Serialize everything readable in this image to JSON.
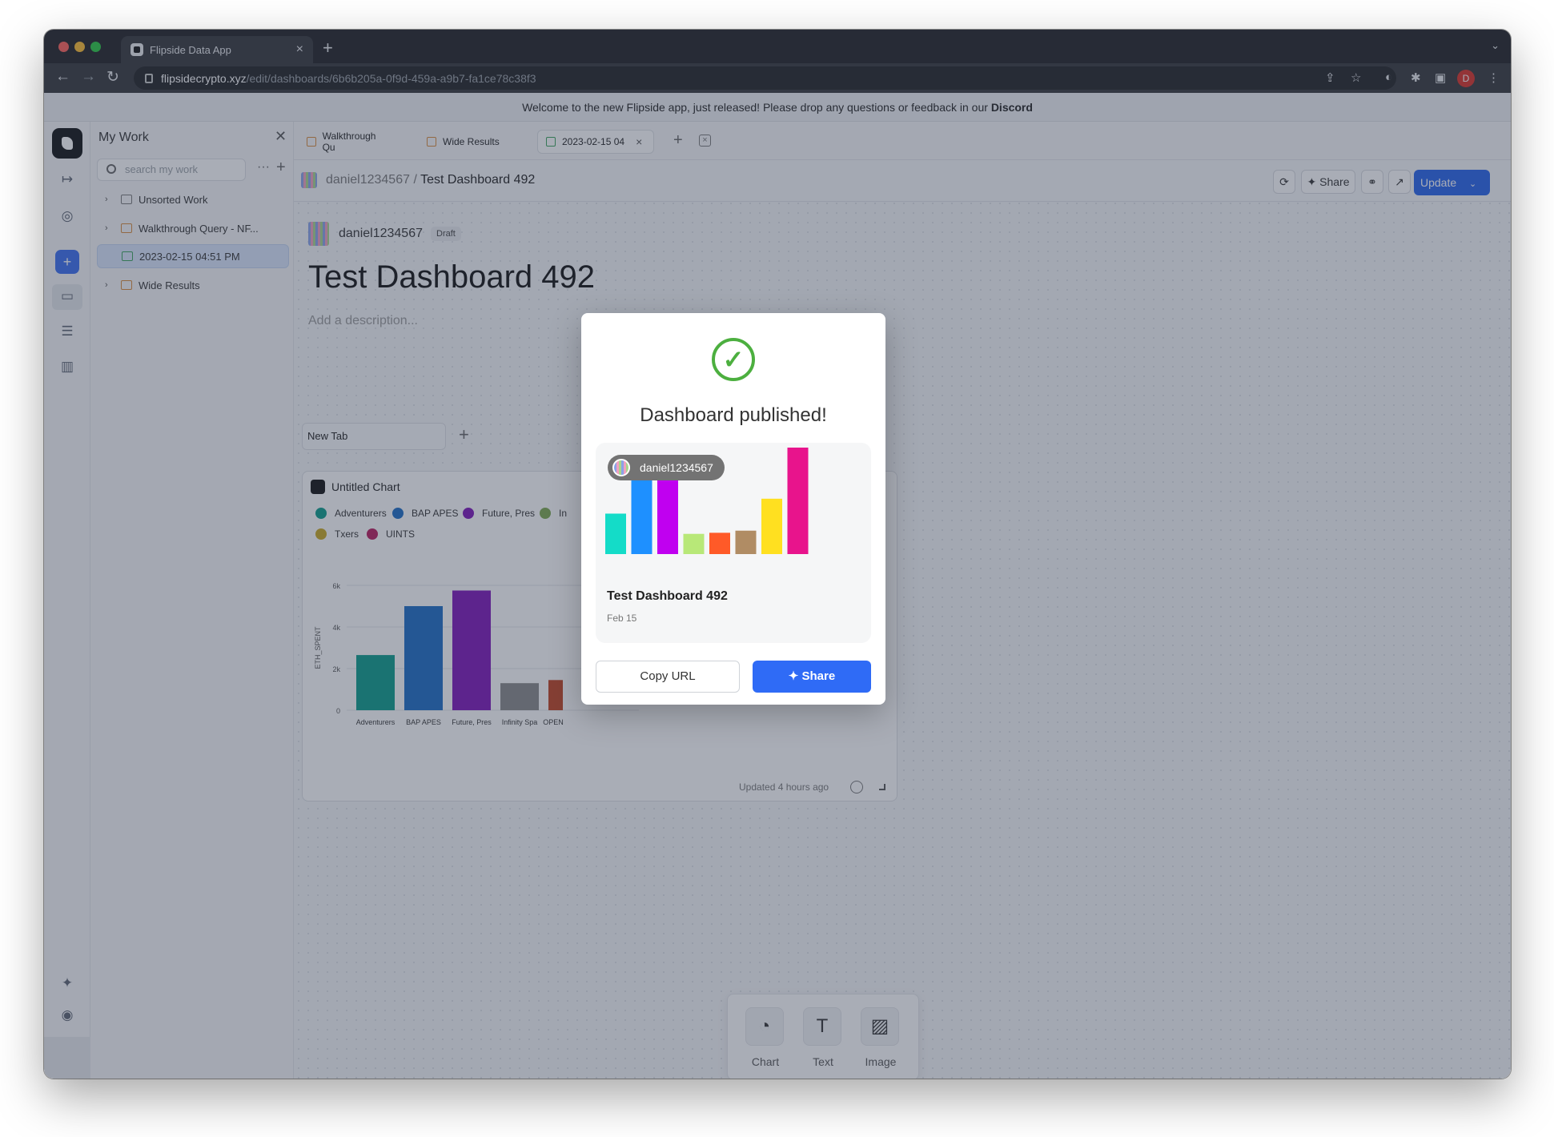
{
  "browser": {
    "tab_title": "Flipside Data App",
    "url_host": "flipsidecrypto.xyz",
    "url_path": "/edit/dashboards/6b6b205a-0f9d-459a-a9b7-fa1ce78c38f3",
    "profile_initial": "D"
  },
  "banner": {
    "text": "Welcome to the new Flipside app, just released! Please drop any questions or feedback in our",
    "link": "Discord"
  },
  "sidebar": {
    "title": "My Work",
    "search_placeholder": "search my work",
    "items": [
      {
        "label": "Unsorted Work",
        "type": "folder"
      },
      {
        "label": "Walkthrough Query - NF...",
        "type": "query"
      },
      {
        "label": "2023-02-15 04:51 PM",
        "type": "dashboard"
      },
      {
        "label": "Wide Results",
        "type": "query"
      }
    ]
  },
  "doc_tabs": [
    {
      "label": "Walkthrough Qu"
    },
    {
      "label": "Wide Results"
    },
    {
      "label": "2023-02-15 04"
    }
  ],
  "header": {
    "owner": "daniel1234567",
    "separator": "/",
    "title": "Test Dashboard 492",
    "share_label": "Share",
    "update_label": "Update"
  },
  "dashboard": {
    "owner": "daniel1234567",
    "status": "Draft",
    "title": "Test Dashboard 492",
    "description_placeholder": "Add a description...",
    "tab_label": "New Tab"
  },
  "chart_card": {
    "title": "Untitled Chart",
    "updated": "Updated 4 hours ago"
  },
  "chart_data": {
    "type": "bar",
    "title": "Untitled Chart",
    "ylabel": "ETH_SPENT",
    "ylim": [
      0,
      6000
    ],
    "y_ticks": [
      "0",
      "2k",
      "4k",
      "6k"
    ],
    "categories": [
      "Adventurers",
      "BAP APES",
      "Future, Pres",
      "Infinity Spa",
      "OPEN"
    ],
    "values": [
      2650,
      5000,
      5750,
      1300,
      1450
    ],
    "legend": [
      "Adventurers",
      "BAP APES",
      "Future, Pres",
      "In",
      "Txers",
      "UINTS"
    ],
    "colors": {
      "Adventurers": "#0a9b8a",
      "BAP APES": "#1b6cc4",
      "Future, Pres": "#7d14b8",
      "In": "#7da84f",
      "Txers": "#c9a820",
      "UINTS": "#b81a5c",
      "OPEN": "#c2431f"
    }
  },
  "add_bar": {
    "items": [
      {
        "label": "Chart",
        "icon": "pie-chart-icon"
      },
      {
        "label": "Text",
        "icon": "text-icon"
      },
      {
        "label": "Image",
        "icon": "image-icon"
      }
    ]
  },
  "modal": {
    "title": "Dashboard published!",
    "preview_owner": "daniel1234567",
    "preview_title": "Test Dashboard 492",
    "preview_date": "Feb 15",
    "preview_bars": [
      {
        "value": 0.38,
        "color": "#14dcc8"
      },
      {
        "value": 0.72,
        "color": "#1e90ff"
      },
      {
        "value": 0.82,
        "color": "#c000f0"
      },
      {
        "value": 0.19,
        "color": "#b8e878"
      },
      {
        "value": 0.2,
        "color": "#ff5a28"
      },
      {
        "value": 0.22,
        "color": "#b08c64"
      },
      {
        "value": 0.52,
        "color": "#ffe020"
      },
      {
        "value": 1.0,
        "color": "#e8148c"
      }
    ],
    "copy_label": "Copy URL",
    "share_label": "Share",
    "accent": "#2f6bf6",
    "success_color": "#4caf3f"
  }
}
